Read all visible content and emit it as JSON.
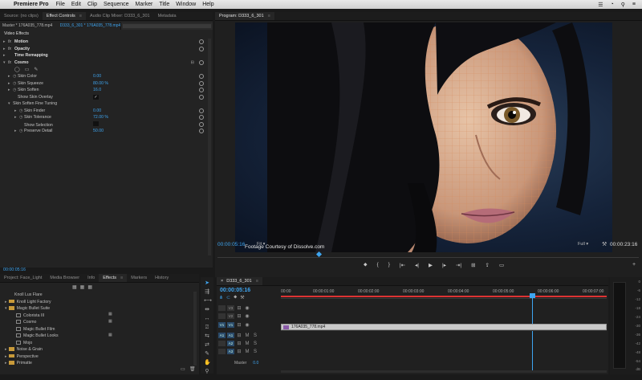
{
  "menubar": {
    "apple": "",
    "app": "Premiere Pro",
    "items": [
      "File",
      "Edit",
      "Clip",
      "Sequence",
      "Marker",
      "Title",
      "Window",
      "Help"
    ],
    "tray": [
      "☰",
      "◔",
      "⚲",
      "≡"
    ]
  },
  "source_panel": {
    "tabs": [
      {
        "label": "Source: (no clips)"
      },
      {
        "label": "Effect Controls",
        "close": "≡"
      },
      {
        "label": "Audio Clip Mixer: D333_6_301"
      },
      {
        "label": "Metadata"
      }
    ],
    "header_clip": "Master * 176A035_778.mp4",
    "header_seq": "D333_6_301 * 176A035_778.mp4",
    "section_label": "Video Effects",
    "effects": [
      {
        "name": "Motion"
      },
      {
        "name": "Opacity"
      },
      {
        "name": "Time Remapping"
      },
      {
        "name": "Cosmo"
      }
    ],
    "params": [
      {
        "name": "Skin Color",
        "value": "0.00"
      },
      {
        "name": "Skin Squeeze",
        "value": "80.00 %"
      },
      {
        "name": "Skin Soften",
        "value": "16.0"
      },
      {
        "name": "Show Skin Overlay",
        "value": "✓"
      },
      {
        "name": "Skin Soften Fine Tuning",
        "value": ""
      },
      {
        "name": "Skin Finder",
        "value": "0.00"
      },
      {
        "name": "Skin Tolerance",
        "value": "72.00 %"
      },
      {
        "name": "Show Selection",
        "value": ""
      },
      {
        "name": "Preserve Detail",
        "value": "50.00"
      }
    ],
    "timecode": "00:00:05:16"
  },
  "program": {
    "title": "Program: D333_6_301",
    "timecode": "00:00:05:16",
    "fit": "Fit",
    "quality": "Full",
    "duration": "00:00:23:16",
    "credit": "Footage Courtesy of Dissolve.com",
    "controls": [
      "⬥",
      "{",
      "}",
      "|⇤",
      "◂|",
      "▶",
      "|▸",
      "⇥|",
      "⊞",
      "⇪",
      "▭"
    ]
  },
  "project": {
    "tabs": [
      {
        "label": "Project: Face_Light"
      },
      {
        "label": "Media Browser"
      },
      {
        "label": "Info"
      },
      {
        "label": "Effects",
        "close": "≡"
      },
      {
        "label": "Markers"
      },
      {
        "label": "History"
      }
    ],
    "items": [
      {
        "label": "Knoll Lux Flare",
        "kind": "item",
        "indent": 1
      },
      {
        "label": "Knoll Light Factory",
        "kind": "folder",
        "indent": 0
      },
      {
        "label": "Magic Bullet Suite",
        "kind": "folder",
        "indent": 0
      },
      {
        "label": "Colorista III",
        "kind": "file",
        "indent": 1
      },
      {
        "label": "Cosmo",
        "kind": "file",
        "indent": 1
      },
      {
        "label": "Magic Bullet Film",
        "kind": "file",
        "indent": 1
      },
      {
        "label": "Magic Bullet Looks",
        "kind": "file",
        "indent": 1
      },
      {
        "label": "Mojo",
        "kind": "file",
        "indent": 1
      },
      {
        "label": "Noise & Grain",
        "kind": "folder",
        "indent": 0
      },
      {
        "label": "Perspective",
        "kind": "folder",
        "indent": 0
      },
      {
        "label": "Primatte",
        "kind": "folder",
        "indent": 0
      }
    ]
  },
  "timeline": {
    "tab": "D333_6_301",
    "timecode": "00:00:05:16",
    "ruler": [
      "00:00",
      "00:00:01:00",
      "00:00:02:00",
      "00:00:03:00",
      "00:00:04:00",
      "00:00:05:00",
      "00:00:06:00",
      "00:00:07:00"
    ],
    "tracks": [
      {
        "id": "V3",
        "src": ""
      },
      {
        "id": "V2",
        "src": ""
      },
      {
        "id": "V1",
        "src": "V1"
      },
      {
        "id": "A1",
        "src": "A1"
      },
      {
        "id": "A2",
        "src": ""
      },
      {
        "id": "A3",
        "src": ""
      }
    ],
    "clip": "176A035_778.mp4",
    "master": "Master",
    "master_val": "0.0"
  },
  "meter": {
    "ticks": [
      "0",
      "-6",
      "-12",
      "-18",
      "-24",
      "-30",
      "-36",
      "-42",
      "-48",
      "-54"
    ],
    "db": "dB"
  },
  "colors": {
    "accent": "#3ea5f0",
    "clip": "#c9c9c9",
    "playhead": "#3ea5f0",
    "redline": "#d33"
  }
}
